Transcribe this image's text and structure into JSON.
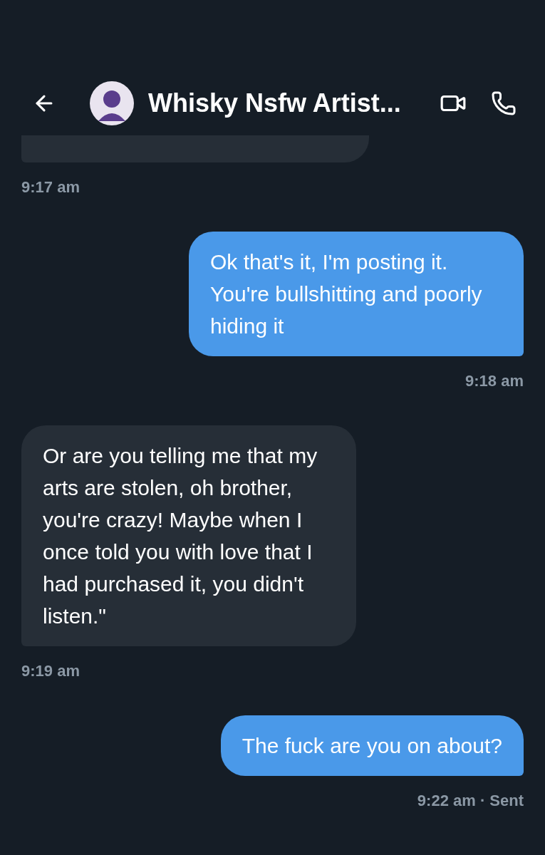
{
  "header": {
    "title": "Whisky Nsfw Artist..."
  },
  "messages": [
    {
      "kind": "cut",
      "outgoing": false,
      "time": "9:17 am"
    },
    {
      "kind": "text",
      "outgoing": true,
      "text": "Ok that's it, I'm posting it. You're bullshitting and poorly hiding it",
      "time": "9:18 am"
    },
    {
      "kind": "text",
      "outgoing": false,
      "text": "Or are you telling me that my arts are stolen, oh brother, you're crazy! Maybe when I once told you with love that I had purchased it, you didn't listen.\"",
      "time": "9:19 am"
    },
    {
      "kind": "text",
      "outgoing": true,
      "text": "The fuck are you on about?",
      "time": "9:22 am · Sent"
    }
  ]
}
